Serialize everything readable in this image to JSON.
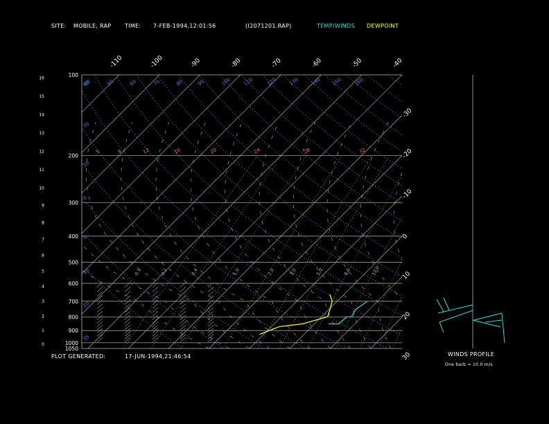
{
  "header": {
    "site_label": "SITE:",
    "site_value": "MOBILE, RAP",
    "time_label": "TIME:",
    "time_value": "7-FEB-1994,12:01:56",
    "file_value": "(I2071201.RAP)",
    "legend_temp": "TEMP/WINDS",
    "legend_dew": "DEWPOINT"
  },
  "footer": {
    "generated_label": "PLOT GENERATED:",
    "generated_value": "17-JUN-1994,21:46:54",
    "winds_title": "WINDS PROFILE",
    "barb_note": "One barb = 10.0 m/s"
  },
  "colors": {
    "temp": "#33dddd",
    "dew": "#ffff33",
    "grid": "#bbbbbb",
    "dry_adiabat": "#4a7fe0",
    "mixing_ratio": "#e08040",
    "moist_adiabat": "#888888",
    "text": "#ffffff"
  },
  "chart_data": {
    "type": "line",
    "pressure_levels": [
      100,
      200,
      300,
      400,
      500,
      600,
      700,
      800,
      900,
      1000,
      1050
    ],
    "pressure_labels": [
      "100",
      "200",
      "300",
      "400",
      "500",
      "600",
      "700",
      "800",
      "900",
      "1000",
      "1050"
    ],
    "height_labels": [
      "16",
      "15",
      "14",
      "13",
      "12",
      "11",
      "10",
      "9",
      "8",
      "7",
      "6",
      "5",
      "4",
      "3",
      "2",
      "1",
      "0"
    ],
    "heights_km": [
      16,
      15,
      14,
      13,
      12,
      11,
      10,
      9,
      8,
      7,
      6,
      5,
      4,
      3,
      2,
      1,
      0
    ],
    "isotherm_top_labels": [
      "-110",
      "-100",
      "-90",
      "-80",
      "-70",
      "-60",
      "-50",
      "-40"
    ],
    "isotherm_right_labels": [
      "-30",
      "-20",
      "-10",
      "0",
      "10",
      "20",
      "30"
    ],
    "dry_adiabat_labels": [
      "60",
      "50",
      "60",
      "70",
      "80",
      "90",
      "100",
      "110",
      "120",
      "130",
      "140",
      "150",
      "160"
    ],
    "mixing_ratio_labels": [
      "5",
      "8",
      "12",
      "16",
      "20",
      "24",
      "28",
      "32"
    ],
    "mixing_ratio_lower_labels": [
      "0.1",
      "0.2",
      "0.4",
      "1.0",
      "2.0",
      "3.0",
      "5.0",
      "8.0",
      "12.0"
    ],
    "series": [
      {
        "name": "TEMP/WINDS",
        "points": [
          [
            850,
            3.5
          ],
          [
            850,
            6.0
          ],
          [
            800,
            6.2
          ],
          [
            800,
            7.5
          ],
          [
            750,
            6.6
          ],
          [
            700,
            7.5
          ]
        ]
      },
      {
        "name": "DEWPOINT",
        "points": [
          [
            930,
            -11
          ],
          [
            870,
            -8
          ],
          [
            850,
            -3
          ],
          [
            800,
            1.5
          ],
          [
            760,
            0.5
          ],
          [
            700,
            -1.2
          ],
          [
            660,
            -3.5
          ]
        ]
      }
    ]
  }
}
